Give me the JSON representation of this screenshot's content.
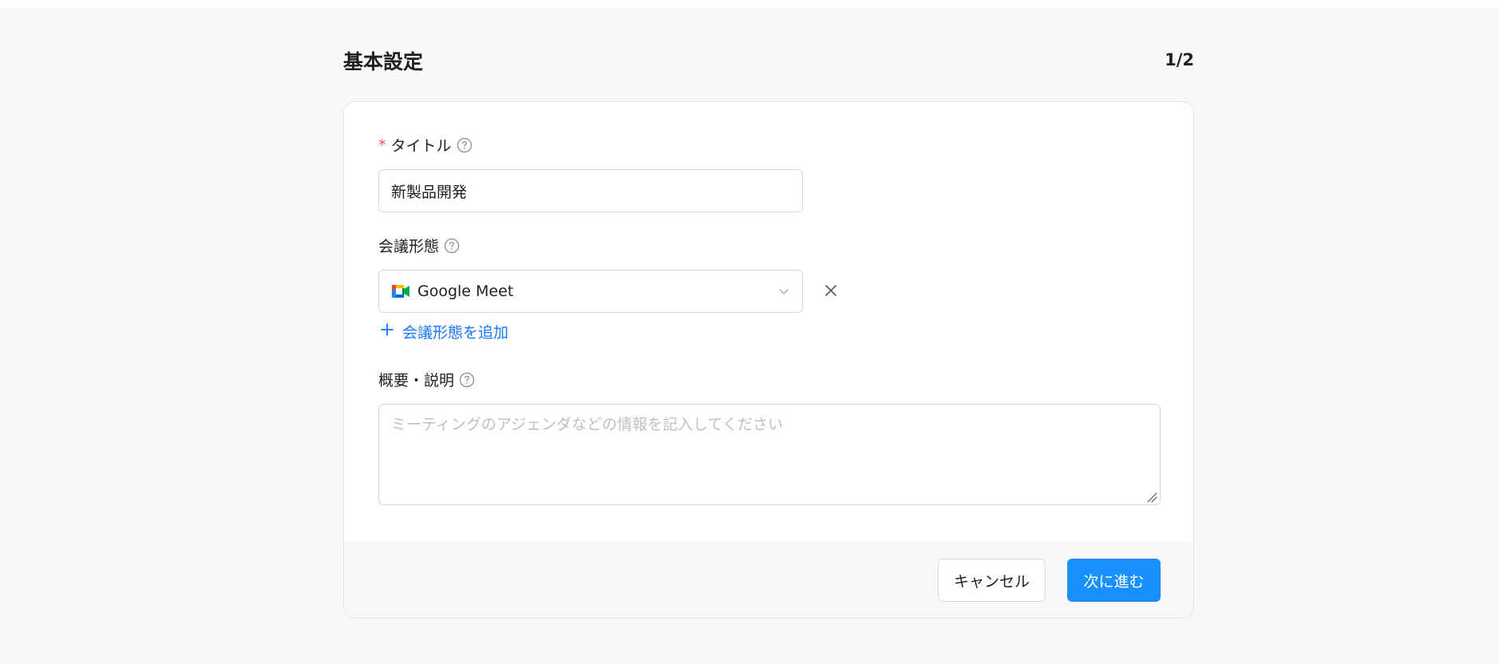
{
  "page": {
    "title": "基本設定",
    "step": "1/2"
  },
  "form": {
    "title_field": {
      "required_mark": "*",
      "label": "タイトル",
      "value": "新製品開発"
    },
    "meeting_type": {
      "label": "会議形態",
      "selected": "Google Meet",
      "selected_icon": "google-meet-icon",
      "add_label": "会議形態を追加"
    },
    "description": {
      "label": "概要・説明",
      "placeholder": "ミーティングのアジェンダなどの情報を記入してください",
      "value": ""
    }
  },
  "footer": {
    "cancel_label": "キャンセル",
    "next_label": "次に進む"
  },
  "colors": {
    "primary": "#1890ff",
    "link": "#1677ff",
    "required": "#ff4d4f",
    "background": "#f7f8fa"
  }
}
